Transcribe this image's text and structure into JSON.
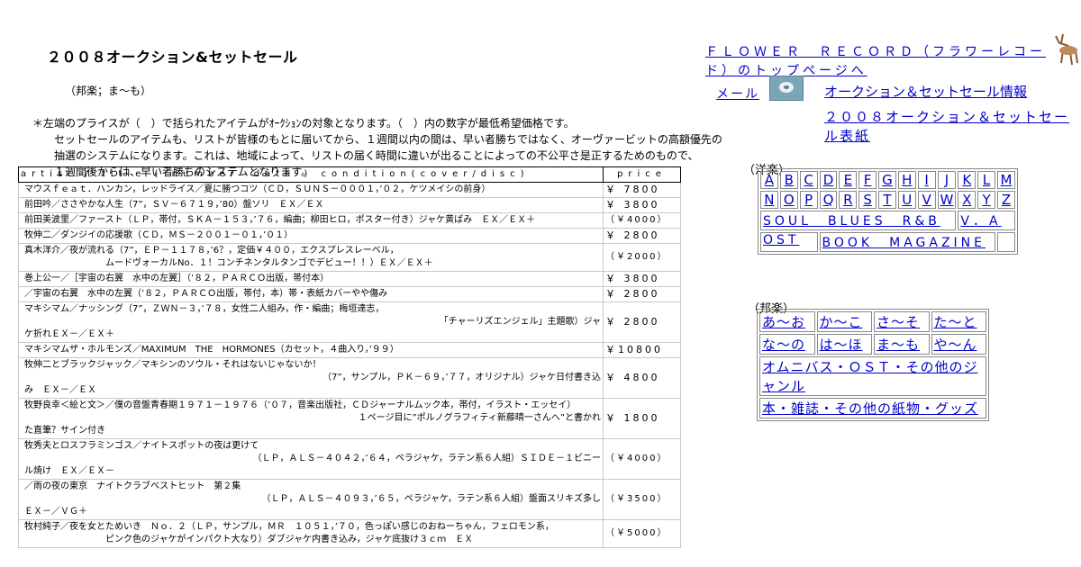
{
  "page": {
    "title": "２００８オークション&セットセール",
    "subtitle": "（邦楽；ま～も）",
    "notes": [
      "＊左端のプライスが（　）で括られたアイテムがｵｰｸｼｮﾝの対象となります。（　）内の数字が最低希望価格です。",
      "セットセールのアイテムも、リストが皆様のもとに届いてから、１週間以内の間は、早い者勝ちではなく、オーヴァービットの高額優先の",
      "抽選のシステムになります。これは、地域によって、リストの届く時間に違いが出ることによっての不公平さ是正するためのもので、",
      "１週間後からは、早い者勝ちのシステムとなります。"
    ]
  },
  "table": {
    "header_item": "artist / title ( number　date ) condition(cover/disc)",
    "header_price": "price",
    "rows": [
      {
        "lines": [
          "マウスｆｅａｔ．ハンカン，レッドライス／夏に勝つコツ（ＣＤ，ＳＵＮＳ－０００１，’０２，ケツメイシの前身）"
        ],
        "price": "￥ 7800"
      },
      {
        "lines": [
          "前田吟／ささやかな人生（7”，ＳＶ－６７１９，’80）盤ソリ　ＥＸ／ＥＸ"
        ],
        "price": "￥ 3800"
      },
      {
        "lines": [
          "前田美波里／ファースト（ＬＰ，帯付，ＳＫＡ－１５３，’７６，編曲；柳田ヒロ，ポスター付き）ジャケ黄ばみ　ＥＸ／ＥＸ＋"
        ],
        "price": "（￥4000）"
      },
      {
        "lines": [
          "牧伸二／ダンジイの応援歌（ＣＤ，ＭＳ－２００１－０１，’０１）"
        ],
        "price": "￥ 2800"
      },
      {
        "lines": [
          "真木洋介／夜が流れる（7”，ＥＰ－１１７８，’6？，定価￥４００，エクスプレスレーベル，",
          "ムードヴォーカルNo．１！コンチネンタルタンゴでデビュー！！）ＥＸ／ＥＸ＋"
        ],
        "price": "（￥2000）"
      },
      {
        "lines": [
          "巻上公一／［宇宙の右翼　水中の左翼］（’８２，ＰＡＲＣＯ出版，帯付本）"
        ],
        "price": "￥ 3800"
      },
      {
        "lines": [
          "／宇宙の右翼　水中の左翼（’８２，ＰＡＲＣＯ出版，帯付，本）帯・表紙カバーやや傷み"
        ],
        "price": "￥ 2800"
      },
      {
        "lines": [
          "マキシマム／ナッシング（7”，ＺＷＮ－３，’７８，女性二人組み，作・編曲；梅垣達志，",
          "「チャーリズエンジェル」主題歌）ジャ",
          "ケ折れＥＸ－／ＥＸ＋"
        ],
        "price": "￥ 2800"
      },
      {
        "lines": [
          "マキシマムザ・ホルモンズ／MAXIMUM　THE　HORMONES（カセット，４曲入り，’９９）"
        ],
        "price": "￥10800"
      },
      {
        "lines": [
          "牧伸二とブラックジャック／マキシンのソウル・それはないじゃないか！",
          "（7”，サンプル，ＰＫ－６９，’７７，オリジナル）ジャケ日付書き込",
          "み　ＥＸ－／ＥＸ"
        ],
        "price": "￥ 4800"
      },
      {
        "lines": [
          "牧野良幸＜絵と文＞／僕の音盤青春期１９７１－１９７６（’０７，音楽出版社，ＣＤジャーナルムック本，帯付，イラスト・エッセイ）",
          "１ページ目に”ポルノグラフィティ新藤晴一さんへ”と書かれ",
          "た直筆？サイン付き"
        ],
        "price": "￥ 1800"
      },
      {
        "lines": [
          "牧秀夫とロスフラミンゴス／ナイトスポットの夜は更けて",
          "（ＬＰ，ＡＬＳ－４０４２，’６４，ペラジャケ，ラテン系６人組）ＳＩＤＥ－１ビニー",
          "ル焼け　ＥＸ／ＥＸ－"
        ],
        "price": "（￥4000）"
      },
      {
        "lines": [
          "／雨の夜の東京　ナイトクラブベストヒット　第２集",
          "（ＬＰ，ＡＬＳ－４０９３，’６５，ペラジャケ，ラテン系６人組）盤面スリキズ多し",
          "ＥＸ－／ＶＧ＋"
        ],
        "price": "（￥3500）"
      },
      {
        "lines": [
          "牧村純子／夜を女とためいき　Ｎｏ．２（ＬＰ，サンプル，ＭＲ　１０５１，’７０，色っぽい感じのおねーちゃん，フェロモン系，",
          "ピンク色のジャケがインパクト大なり）ダブジャケ内書き込み，ジャケ底抜け３ｃｍ　ＥＸ"
        ],
        "price": "（￥5000）"
      }
    ]
  },
  "nav": {
    "flower_link": "ＦＬＯＷＥＲ　ＲＥＣＯＲＤ（フラワーレコード）のトップページへ",
    "mail_link": "メール",
    "info_link": "オークション＆セットセール情報",
    "cover_link": "２００８オークション＆セットセール表紙",
    "yogaku_label": "（洋楽）",
    "hogaku_label": "（邦楽）",
    "letters_row1": [
      "A",
      "B",
      "C",
      "D",
      "E",
      "F",
      "G",
      "H",
      "I",
      "J",
      "K",
      "L",
      "M"
    ],
    "letters_row2": [
      "N",
      "O",
      "P",
      "Q",
      "R",
      "S",
      "T",
      "U",
      "V",
      "W",
      "X",
      "Y",
      "Z"
    ],
    "soul_link": "SOUL　BLUES　R&B",
    "va_link": "V．A",
    "ost_link": "OST",
    "book_link": "BOOK　MAGAZINE",
    "kana": [
      "あ～お",
      "か～こ",
      "さ～そ",
      "た～と",
      "な～の",
      "は～ほ",
      "ま～も",
      "や～ん"
    ],
    "omnibus_link": "オムニバス・ＯＳＴ・その他のジャンル",
    "books_link": "本・雑誌・その他の紙物・グッズ"
  },
  "icons": {
    "mail": "mail-icon",
    "deco": "deer-figure-icon"
  }
}
